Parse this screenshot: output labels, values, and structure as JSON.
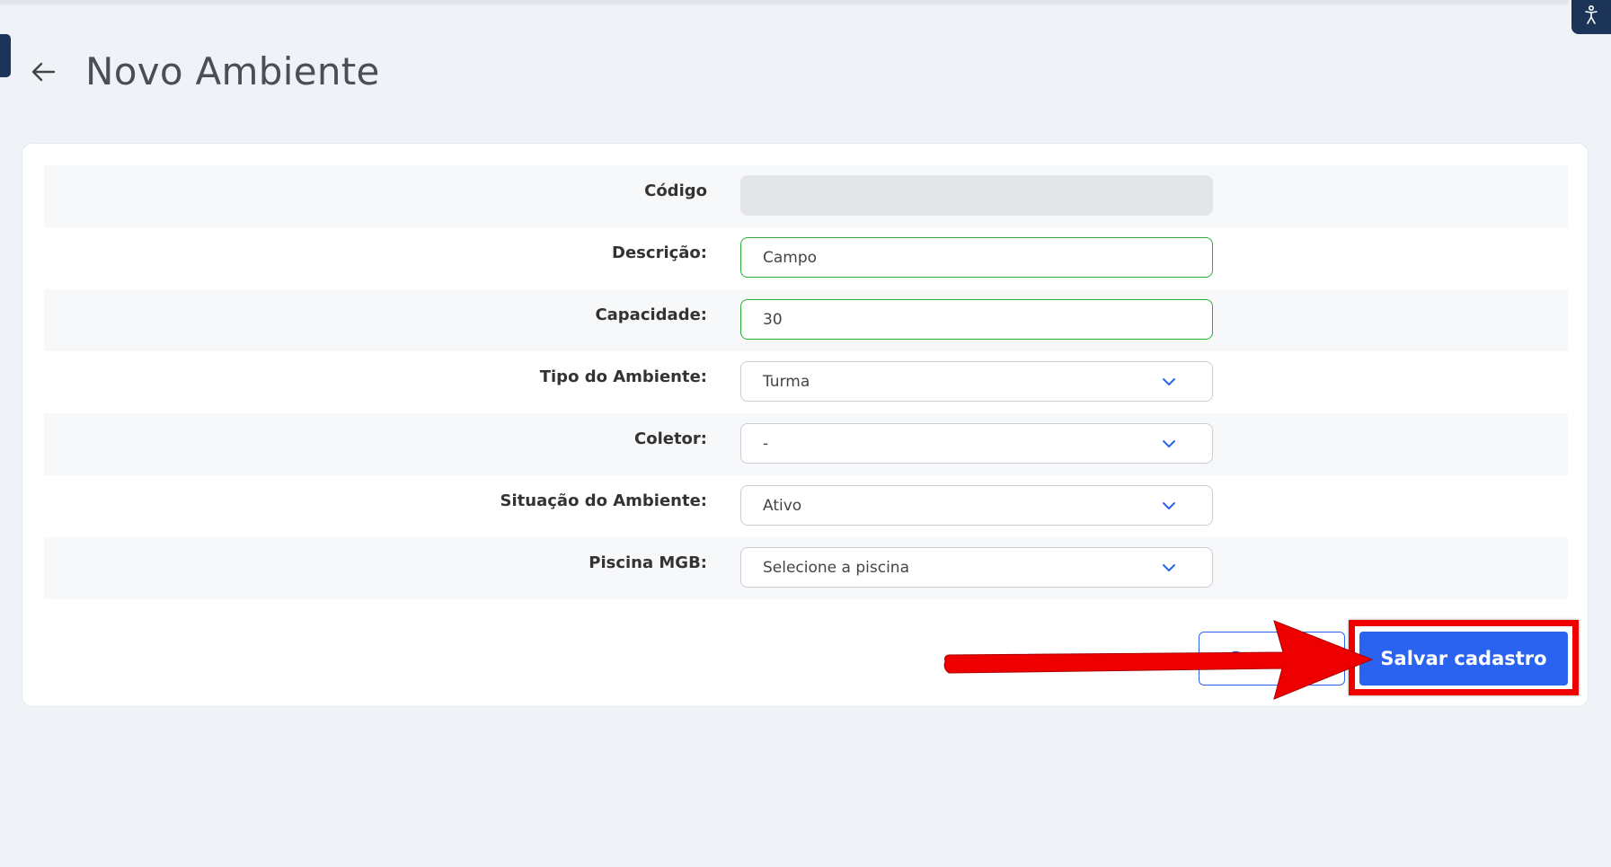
{
  "header": {
    "title": "Novo Ambiente",
    "back_icon": "arrow-left-icon",
    "accessibility_icon": "accessibility-icon"
  },
  "form": {
    "fields": [
      {
        "label": "Código",
        "value": "",
        "kind": "disabled-input"
      },
      {
        "label": "Descrição:",
        "value": "Campo",
        "kind": "text-input"
      },
      {
        "label": "Capacidade:",
        "value": "30",
        "kind": "text-input"
      },
      {
        "label": "Tipo do Ambiente:",
        "value": "Turma",
        "kind": "select"
      },
      {
        "label": "Coletor:",
        "value": "-",
        "kind": "select"
      },
      {
        "label": "Situação do Ambiente:",
        "value": "Ativo",
        "kind": "select"
      },
      {
        "label": "Piscina MGB:",
        "value": "Selecione a piscina",
        "kind": "select"
      }
    ]
  },
  "actions": {
    "cancel_label": "Cancelar",
    "save_label": "Salvar cadastro"
  },
  "colors": {
    "background": "#eff2f7",
    "primary": "#2a63f0",
    "valid_border": "#2eab3a",
    "annotation_red": "#ee0000",
    "header_dark": "#1b3458"
  }
}
